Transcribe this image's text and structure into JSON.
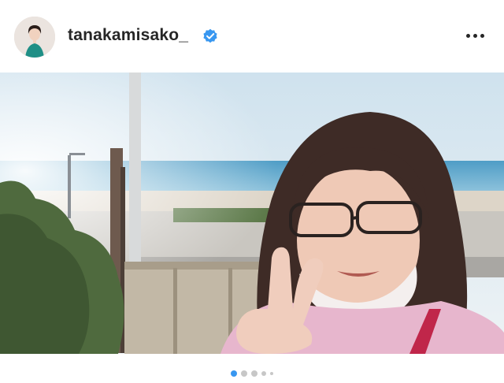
{
  "post": {
    "username": "tanakamisako_",
    "verified": true
  },
  "icons": {
    "verified": "verified-badge-icon",
    "more": "more-options-icon"
  },
  "carousel": {
    "slide_count": 5,
    "active_index": 0
  },
  "colors": {
    "accent": "#3897f0",
    "text": "#262626",
    "dot_inactive": "#c7c7c7"
  }
}
